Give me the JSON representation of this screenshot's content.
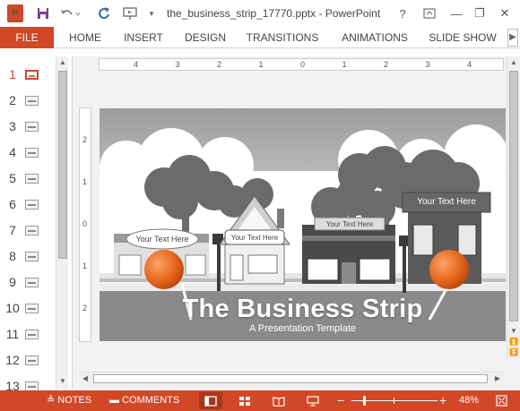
{
  "window": {
    "title": "the_business_strip_17770.pptx - PowerPoint",
    "help_glyph": "?",
    "minimize_glyph": "—",
    "restore_glyph": "❐",
    "close_glyph": "✕"
  },
  "ribbon": {
    "tabs": [
      "FILE",
      "HOME",
      "INSERT",
      "DESIGN",
      "TRANSITIONS",
      "ANIMATIONS",
      "SLIDE SHOW"
    ],
    "more_glyph": "▶"
  },
  "thumbnails": {
    "numbers": [
      "1",
      "2",
      "3",
      "4",
      "5",
      "6",
      "7",
      "8",
      "9",
      "10",
      "11",
      "12",
      "13"
    ],
    "active_index": 0
  },
  "ruler": {
    "h_labels": [
      "4",
      "3",
      "2",
      "1",
      "0",
      "1",
      "2",
      "3",
      "4"
    ],
    "v_labels": [
      "2",
      "1",
      "0",
      "1",
      "2"
    ]
  },
  "slide": {
    "title": "The Business Strip",
    "subtitle": "A Presentation Template",
    "bubble_text": "Your Text Here",
    "sign_small_1": "Your Text Here",
    "sign_small_2": "Your Text Here",
    "sign_large": "Your Text Here"
  },
  "status": {
    "notes": "NOTES",
    "comments": "COMMENTS",
    "zoom": "48%",
    "zoom_minus": "−",
    "zoom_plus": "+"
  },
  "colors": {
    "accent": "#d24726",
    "pin": "#e8691d"
  }
}
